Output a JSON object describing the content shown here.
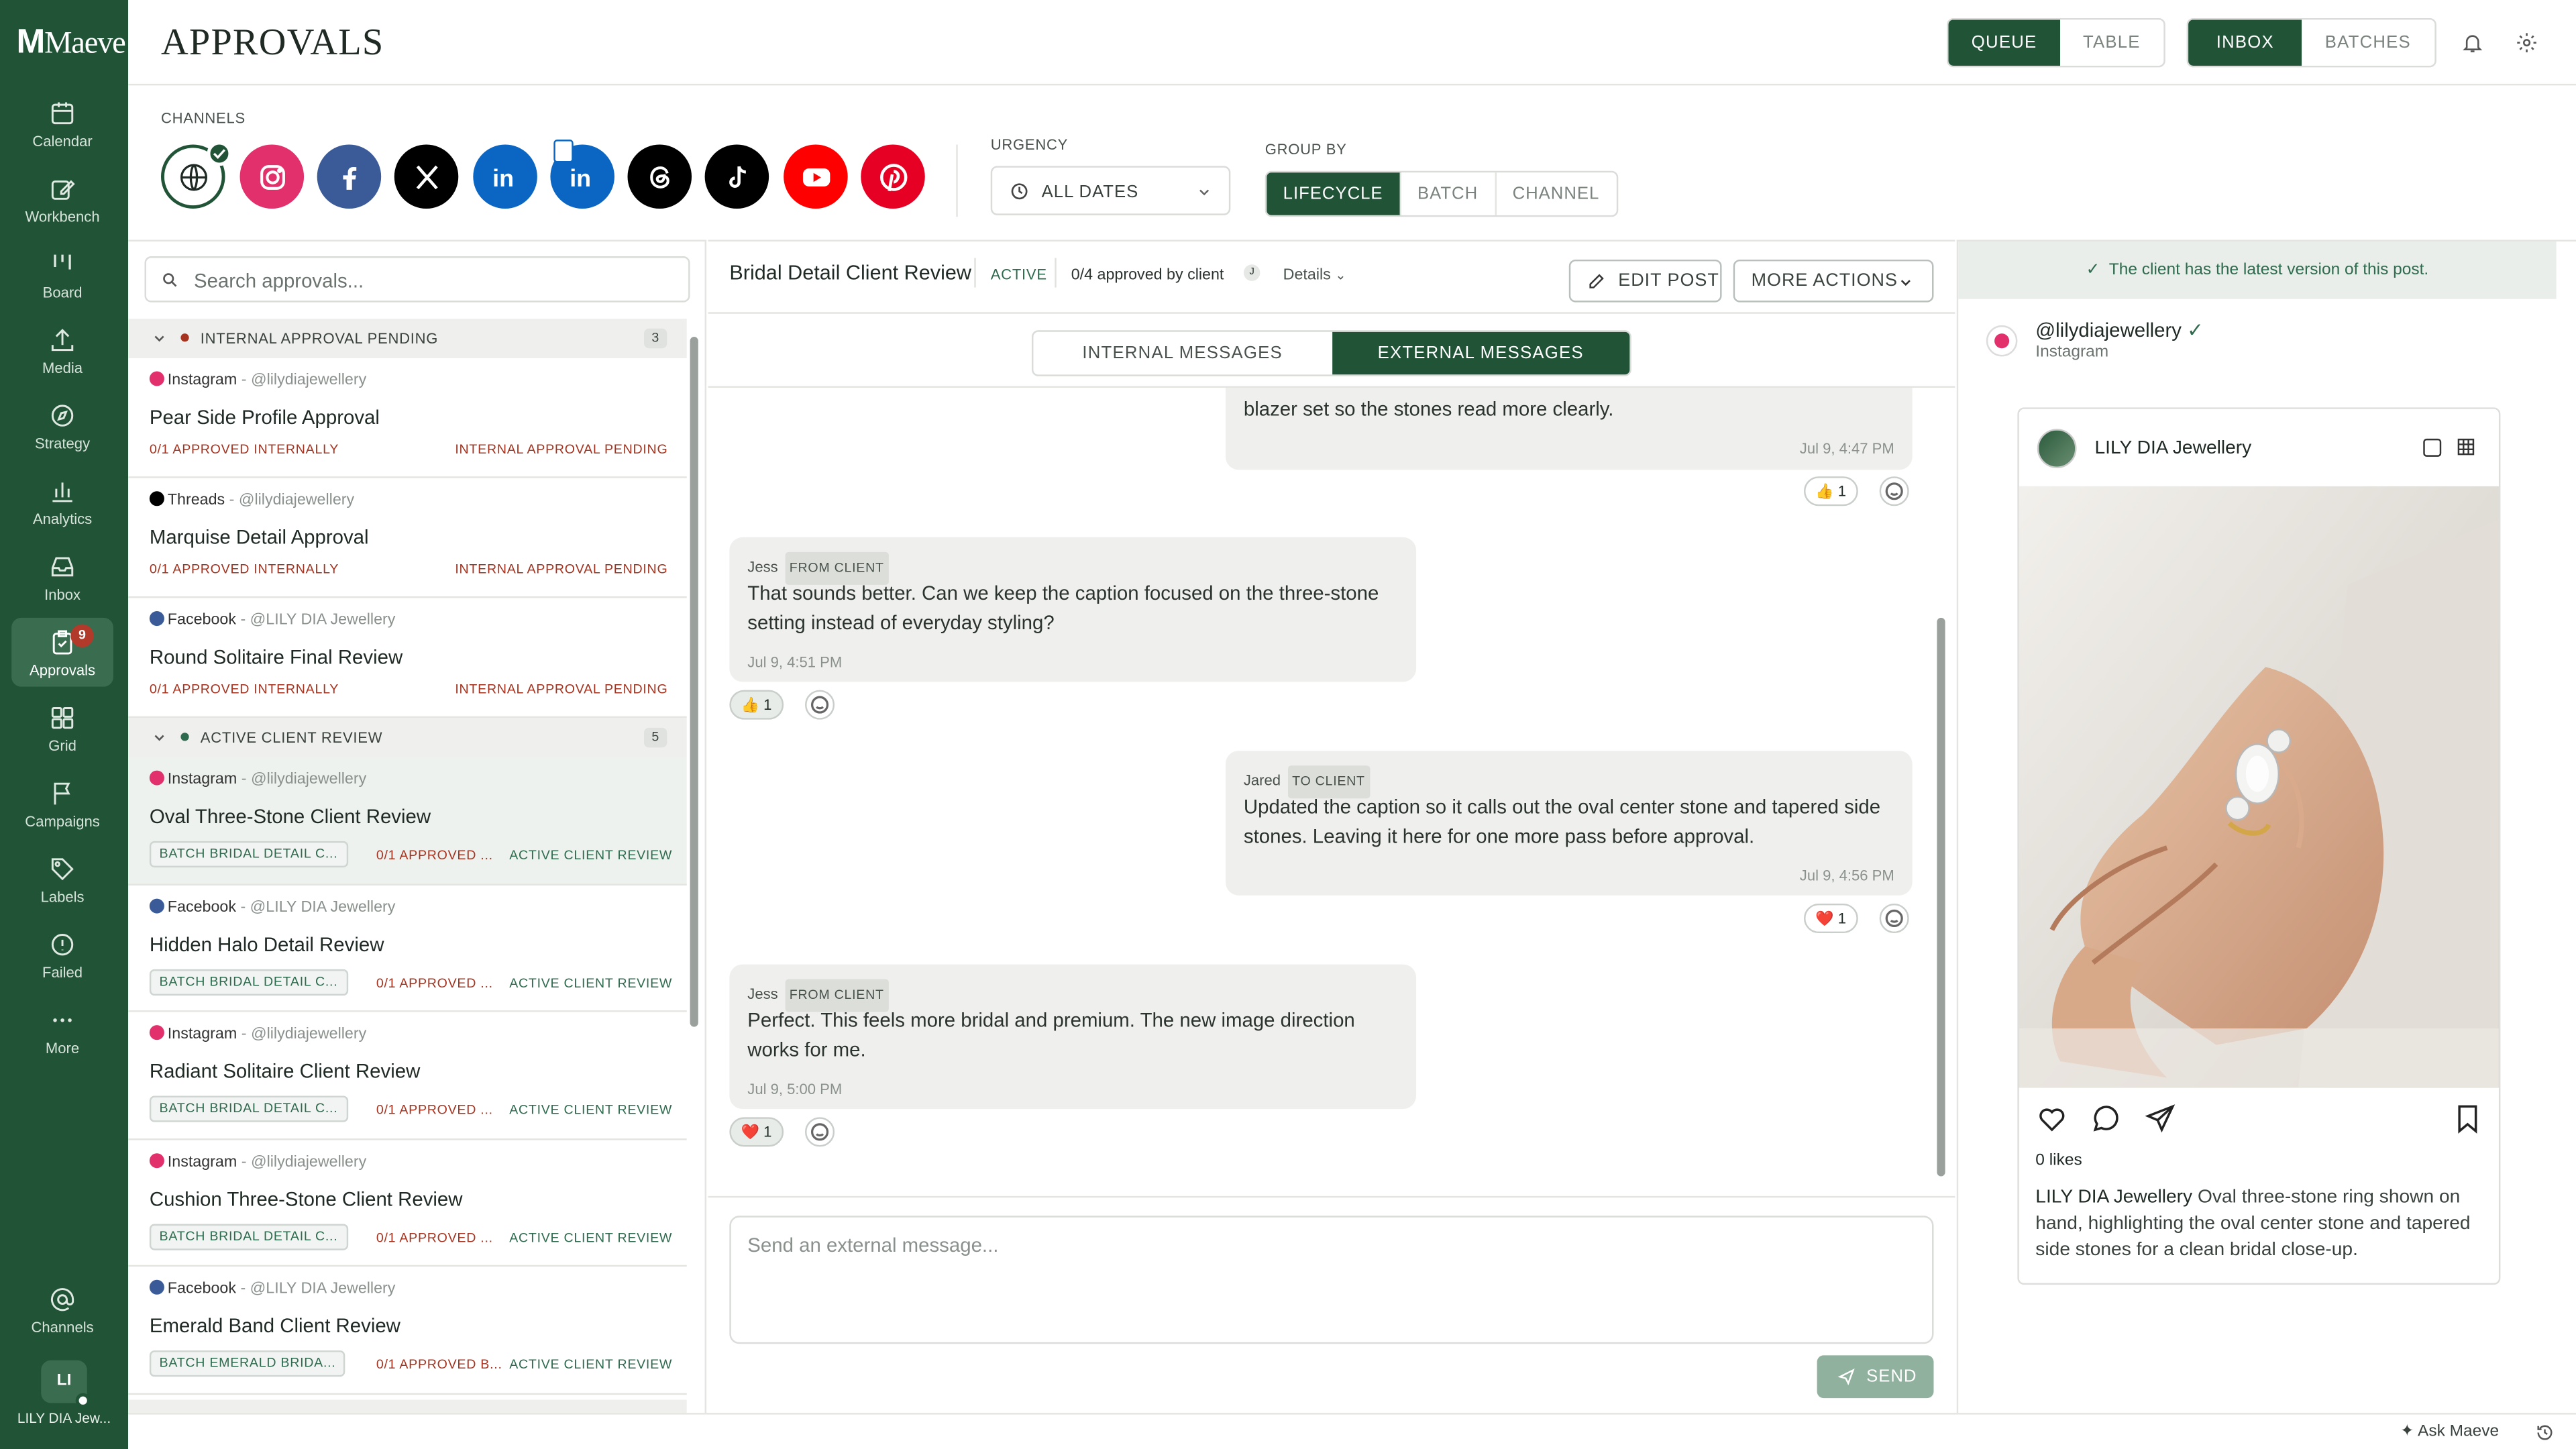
{
  "app": {
    "logo": "Maeve",
    "page_title": "APPROVALS"
  },
  "sidebar": {
    "items": [
      {
        "label": "Calendar",
        "icon": "calendar-icon"
      },
      {
        "label": "Workbench",
        "icon": "edit-icon"
      },
      {
        "label": "Board",
        "icon": "board-icon"
      },
      {
        "label": "Media",
        "icon": "upload-icon"
      },
      {
        "label": "Strategy",
        "icon": "compass-icon"
      },
      {
        "label": "Analytics",
        "icon": "bar-chart-icon"
      },
      {
        "label": "Inbox",
        "icon": "inbox-icon"
      },
      {
        "label": "Approvals",
        "icon": "clipboard-check-icon",
        "badge": "9",
        "active": true
      },
      {
        "label": "Grid",
        "icon": "grid-icon"
      },
      {
        "label": "Campaigns",
        "icon": "flag-icon"
      },
      {
        "label": "Labels",
        "icon": "tag-icon"
      },
      {
        "label": "Failed",
        "icon": "alert-circle-icon"
      },
      {
        "label": "More",
        "icon": "more-icon"
      }
    ],
    "channels_label": "Channels",
    "account_initials": "LI",
    "account_name": "LILY DIA Jew..."
  },
  "header": {
    "view_toggle": [
      "QUEUE",
      "TABLE"
    ],
    "view_active": "QUEUE",
    "mode_toggle": [
      "INBOX",
      "BATCHES"
    ],
    "mode_active": "INBOX"
  },
  "filters": {
    "channels_label": "CHANNELS",
    "channels": [
      "all-channels",
      "instagram",
      "facebook",
      "x",
      "linkedin",
      "linkedin-page",
      "threads",
      "tiktok",
      "youtube",
      "pinterest"
    ],
    "urgency_label": "URGENCY",
    "urgency_value": "ALL DATES",
    "group_by_label": "GROUP BY",
    "group_by_options": [
      "LIFECYCLE",
      "BATCH",
      "CHANNEL"
    ],
    "group_by_active": "LIFECYCLE"
  },
  "list": {
    "search_placeholder": "Search approvals...",
    "groups": [
      {
        "title": "INTERNAL APPROVAL PENDING",
        "count": "3"
      },
      {
        "title": "ACTIVE CLIENT REVIEW",
        "count": "5"
      }
    ],
    "items": [
      {
        "network": "Instagram",
        "handle": "- @lilydiajewellery",
        "title": "Pear Side Profile Approval",
        "left": "0/1 APPROVED INTERNALLY",
        "status": "INTERNAL APPROVAL PENDING"
      },
      {
        "network": "Threads",
        "handle": "- @lilydiajewellery",
        "title": "Marquise Detail Approval",
        "left": "0/1 APPROVED INTERNALLY",
        "status": "INTERNAL APPROVAL PENDING"
      },
      {
        "network": "Facebook",
        "handle": "- @LILY DIA Jewellery",
        "title": "Round Solitaire Final Review",
        "left": "0/1 APPROVED INTERNALLY",
        "status": "INTERNAL APPROVAL PENDING"
      },
      {
        "network": "Instagram",
        "handle": "- @lilydiajewellery",
        "title": "Oval Three-Stone Client Review",
        "batch": "BATCH BRIDAL DETAIL C...",
        "left": "0/1 APPROVED ...",
        "status": "ACTIVE CLIENT REVIEW"
      },
      {
        "network": "Facebook",
        "handle": "- @LILY DIA Jewellery",
        "title": "Hidden Halo Detail Review",
        "batch": "BATCH BRIDAL DETAIL C...",
        "left": "0/1 APPROVED ...",
        "status": "ACTIVE CLIENT REVIEW"
      },
      {
        "network": "Instagram",
        "handle": "- @lilydiajewellery",
        "title": "Radiant Solitaire Client Review",
        "batch": "BATCH BRIDAL DETAIL C...",
        "left": "0/1 APPROVED ...",
        "status": "ACTIVE CLIENT REVIEW"
      },
      {
        "network": "Instagram",
        "handle": "- @lilydiajewellery",
        "title": "Cushion Three-Stone Client Review",
        "batch": "BATCH BRIDAL DETAIL C...",
        "left": "0/1 APPROVED ...",
        "status": "ACTIVE CLIENT REVIEW"
      },
      {
        "network": "Facebook",
        "handle": "- @LILY DIA Jewellery",
        "title": "Emerald Band Client Review",
        "batch": "BATCH EMERALD BRIDA...",
        "left": "0/1 APPROVED B...",
        "status": "ACTIVE CLIENT REVIEW"
      }
    ]
  },
  "detail": {
    "title": "Bridal Detail Client Review",
    "status": "ACTIVE",
    "approved": "0/4 approved by client",
    "approver_initial": "J",
    "details_label": "Details",
    "edit_label": "EDIT POST",
    "more_label": "MORE ACTIONS",
    "tabs": [
      "INTERNAL MESSAGES",
      "EXTERNAL MESSAGES"
    ],
    "tab_active": "EXTERNAL MESSAGES",
    "messages": [
      {
        "side": "right",
        "text": "blazer set so the stones read more clearly.",
        "time": "Jul 9, 4:47 PM",
        "reaction": "👍",
        "count": "1"
      },
      {
        "side": "left",
        "author": "Jess",
        "tag": "FROM CLIENT",
        "text": "That sounds better. Can we keep the caption focused on the three-stone setting instead of everyday styling?",
        "time": "Jul 9, 4:51 PM",
        "reaction": "👍",
        "count": "1"
      },
      {
        "side": "right",
        "author": "Jared",
        "tag": "TO CLIENT",
        "text": "Updated the caption so it calls out the oval center stone and tapered side stones. Leaving it here for one more pass before approval.",
        "time": "Jul 9, 4:56 PM",
        "reaction": "❤️",
        "count": "1"
      },
      {
        "side": "left",
        "author": "Jess",
        "tag": "FROM CLIENT",
        "text": "Perfect. This feels more bridal and premium. The new image direction works for me.",
        "time": "Jul 9, 5:00 PM",
        "reaction": "❤️",
        "count": "1"
      }
    ],
    "compose_placeholder": "Send an external message...",
    "send_label": "SEND"
  },
  "preview": {
    "banner": "The client has the latest version of this post.",
    "handle": "@lilydiajewellery",
    "network": "Instagram",
    "account_name": "LILY DIA Jewellery",
    "likes": "0 likes",
    "caption_author": "LILY DIA Jewellery",
    "caption": "Oval three-stone ring shown on hand, highlighting the oval center stone and tapered side stones for a clean bridal close-up."
  },
  "footer": {
    "assistant_label": "Ask Maeve"
  },
  "colors": {
    "brand": "#215437",
    "instagram": "#e1306c",
    "facebook": "#1877f2",
    "linkedin": "#0a66c2",
    "youtube": "#ff0000",
    "pinterest": "#e60023",
    "status_red": "#a5331f"
  }
}
